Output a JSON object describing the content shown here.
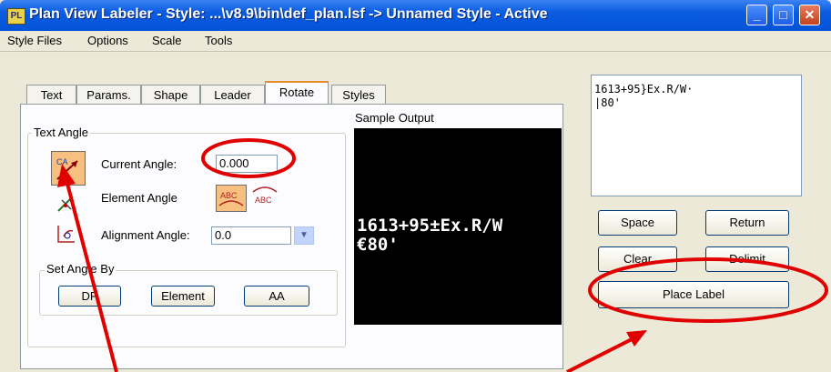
{
  "window": {
    "title": "Plan View Labeler - Style: ...\\v8.9\\bin\\def_plan.lsf -> Unnamed Style - Active",
    "icon_label": "PL",
    "controls": {
      "minimize": "_",
      "maximize": "□",
      "close": "✕"
    }
  },
  "menu": [
    "Style Files",
    "Options",
    "Scale",
    "Tools"
  ],
  "tabs": [
    "Text",
    "Params.",
    "Shape",
    "Leader",
    "Rotate",
    "Styles"
  ],
  "active_tab": "Rotate",
  "text_angle": {
    "group_title": "Text Angle",
    "current_angle_label": "Current Angle:",
    "current_angle_value": "0.000",
    "element_angle_label": "Element Angle",
    "alignment_angle_label": "Alignment Angle:",
    "alignment_angle_value": "0.0",
    "element_angle_icon_text_1": "ABC",
    "element_angle_icon_text_2": "ABC",
    "ca_icon_text": "CA"
  },
  "set_angle_by": {
    "group_title": "Set Angle By",
    "buttons": [
      "DP",
      "Element",
      "AA"
    ]
  },
  "sample_output": {
    "label": "Sample Output",
    "line1": "1613+95±Ex.R/W",
    "line2": "€80'"
  },
  "label_text": {
    "line1": "1613+95}Ex.R/W·",
    "line2": "|80'"
  },
  "buttons": {
    "space": "Space",
    "return": "Return",
    "clear": "Clear",
    "delimit": "Delimit",
    "place_label": "Place Label"
  },
  "annotation_colors": {
    "highlight": "#e00000"
  }
}
